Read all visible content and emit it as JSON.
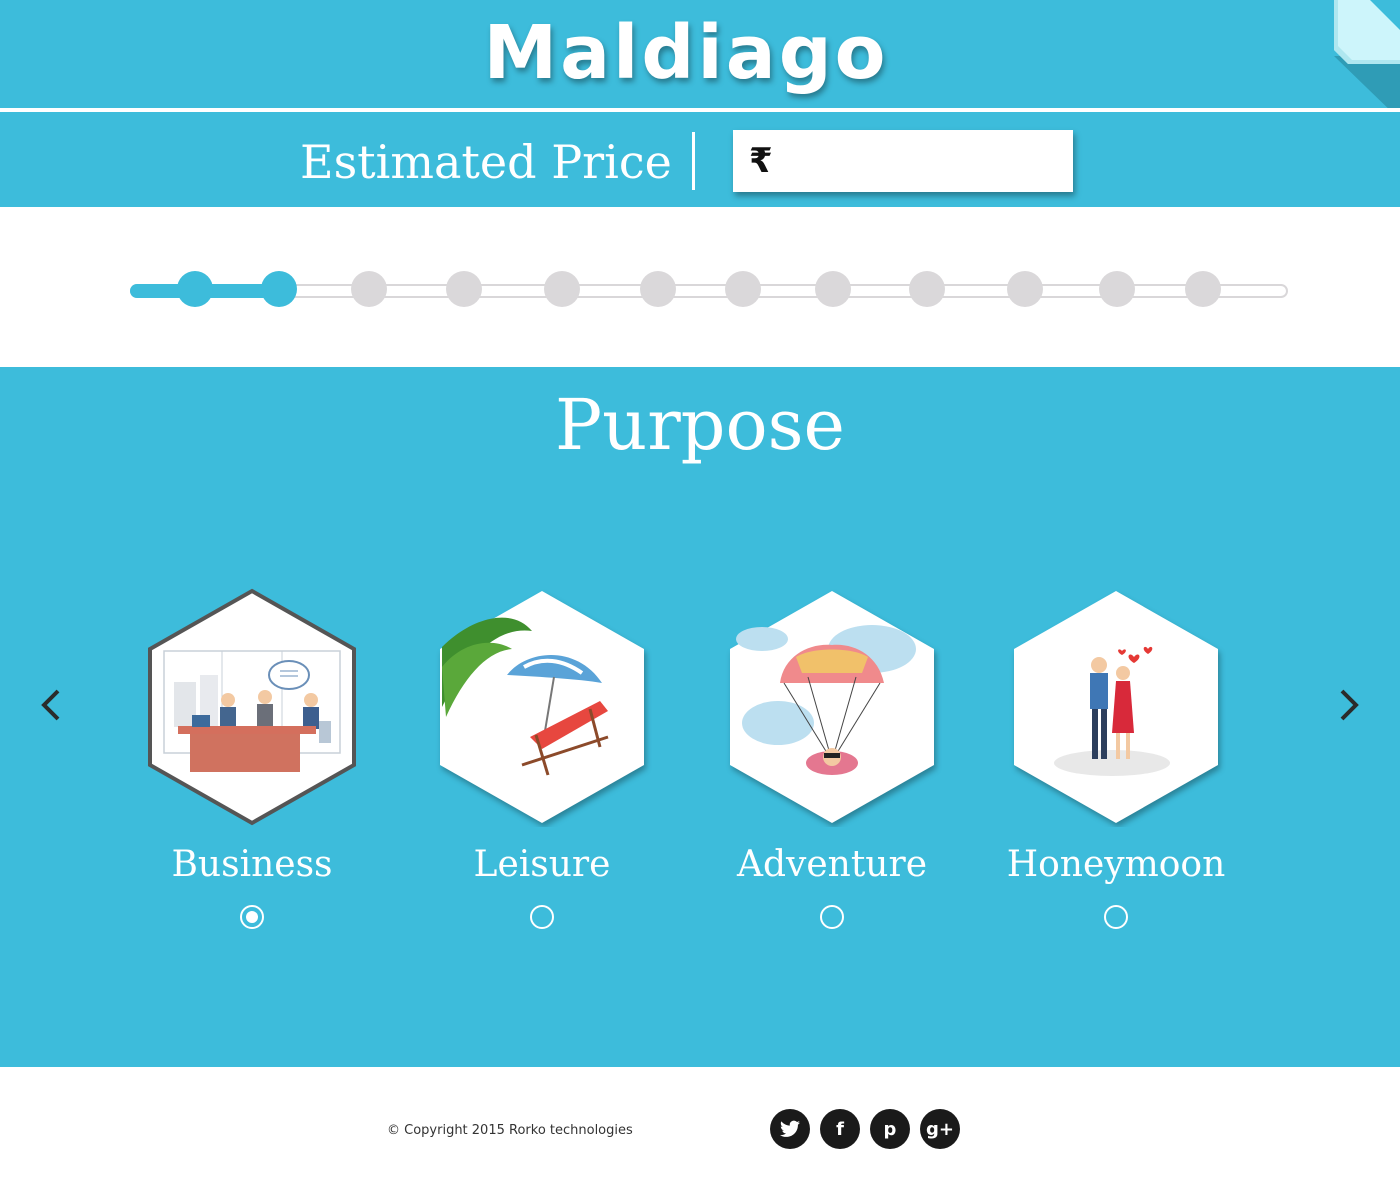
{
  "header": {
    "brand": "Maldiago"
  },
  "price": {
    "label": "Estimated Price",
    "currency_symbol": "₹",
    "value": ""
  },
  "progress": {
    "total_steps": 12,
    "completed_steps": 2
  },
  "section": {
    "title": "Purpose"
  },
  "purposes": [
    {
      "label": "Business",
      "icon": "business-meeting-icon",
      "selected": true
    },
    {
      "label": "Leisure",
      "icon": "beach-chair-icon",
      "selected": false
    },
    {
      "label": "Adventure",
      "icon": "paragliding-icon",
      "selected": false
    },
    {
      "label": "Honeymoon",
      "icon": "couple-icon",
      "selected": false
    }
  ],
  "footer": {
    "copyright": "© Copyright 2015 Rorko technologies",
    "social": [
      {
        "name": "twitter",
        "glyph": "t"
      },
      {
        "name": "facebook",
        "glyph": "f"
      },
      {
        "name": "pinterest",
        "glyph": "p"
      },
      {
        "name": "google-plus",
        "glyph": "g+"
      }
    ]
  },
  "colors": {
    "primary": "#3dbcdb",
    "inactive": "#dad8da",
    "footer_icon": "#1a1a1a"
  }
}
